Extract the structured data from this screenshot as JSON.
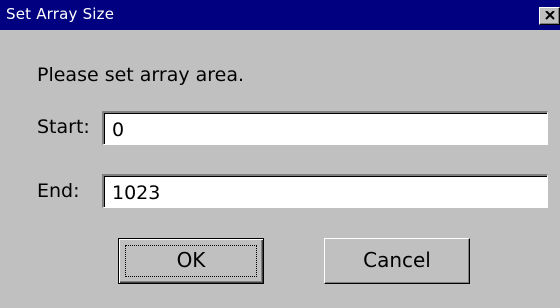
{
  "window": {
    "title": "Set Array Size"
  },
  "dialog": {
    "prompt": "Please set array area.",
    "start_label": "Start:",
    "start_value": "0",
    "end_label": "End:",
    "end_value": "1023",
    "ok_label": "OK",
    "cancel_label": "Cancel"
  },
  "icons": {
    "close": "close-icon"
  },
  "colors": {
    "titlebar": "#000080",
    "window_face": "#c0c0c0",
    "field_bg": "#ffffff"
  }
}
